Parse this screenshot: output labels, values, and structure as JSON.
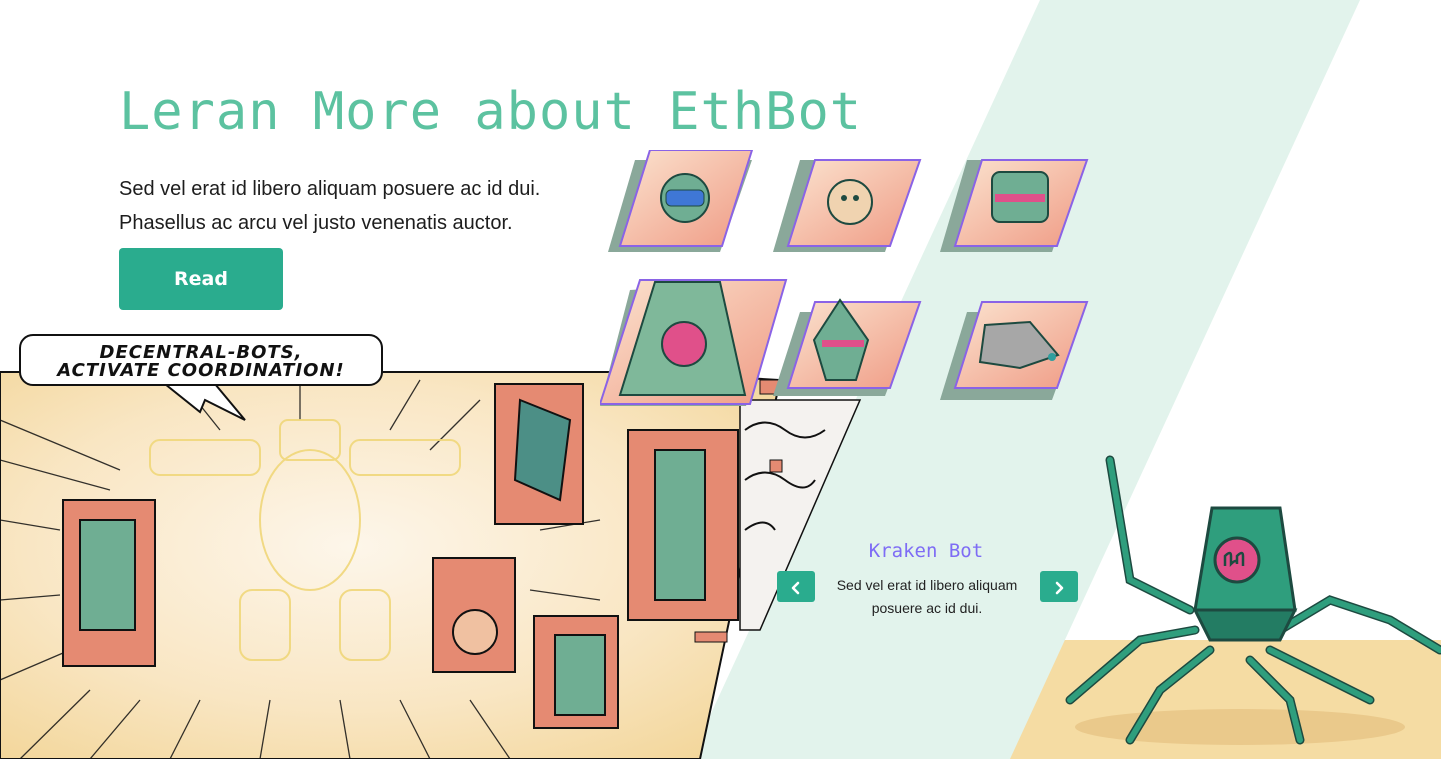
{
  "hero": {
    "title": "Leran More about EthBot",
    "text_line1": "Sed vel erat id libero aliquam posuere ac id dui.",
    "text_line2": "Phasellus ac arcu vel justo venenatis auctor.",
    "read_label": "Read"
  },
  "comic": {
    "speech_line1": "DECENTRAL-BOTS,",
    "speech_line2": "ACTIVATE COORDINATION!"
  },
  "gallery": {
    "tiles": [
      "astronaut-bot",
      "orb-bot",
      "visor-bot",
      "kraken-bot",
      "knight-bot",
      "wolf-bot"
    ]
  },
  "carousel": {
    "title": "Kraken Bot",
    "text": "Sed vel erat id libero aliquam posuere ac id dui.",
    "prev_icon": "chevron-left-icon",
    "next_icon": "chevron-right-icon"
  },
  "colors": {
    "accent": "#2aac8e",
    "title": "#5cc2a0",
    "caption": "#7e6cf5",
    "band": "#e2f3ec",
    "floor": "#f5dca3"
  }
}
